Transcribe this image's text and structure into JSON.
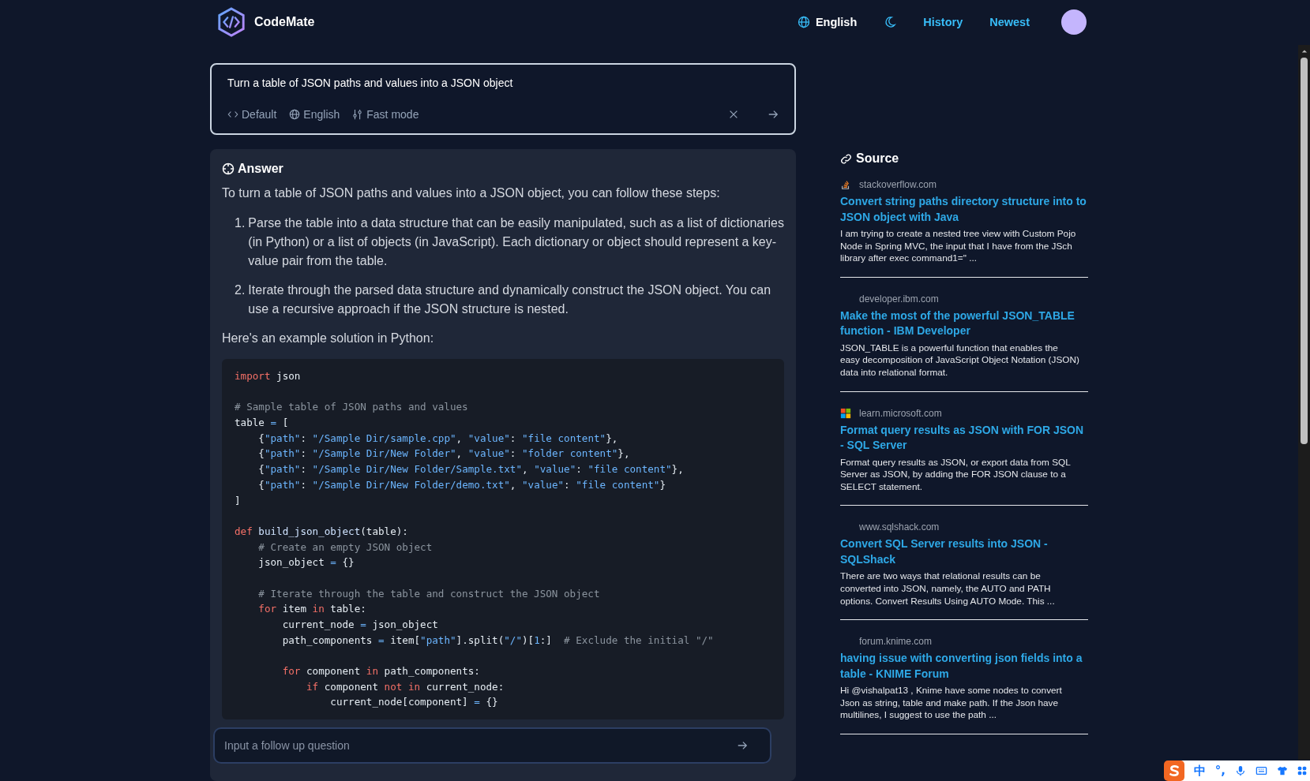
{
  "header": {
    "brand": "CodeMate",
    "language": "English",
    "nav": [
      {
        "label": "History"
      },
      {
        "label": "Newest"
      }
    ]
  },
  "search": {
    "query": "Turn a table of JSON paths and values into a JSON object",
    "options": [
      {
        "kind": "code",
        "label": "Default"
      },
      {
        "kind": "globe",
        "label": "English"
      },
      {
        "kind": "sliders",
        "label": "Fast mode"
      }
    ]
  },
  "answer": {
    "title": "Answer",
    "intro": "To turn a table of JSON paths and values into a JSON object, you can follow these steps:",
    "steps": [
      {
        "num": "1.",
        "text": "Parse the table into a data structure that can be easily manipulated, such as a list of dictionaries (in Python) or a list of objects (in JavaScript). Each dictionary or object should represent a key-value pair from the table."
      },
      {
        "num": "2.",
        "text": "Iterate through the parsed data structure and dynamically construct the JSON object. You can use a recursive approach if the JSON structure is nested."
      }
    ],
    "outro": "Here's an example solution in Python:",
    "code": [
      {
        "kind": "code",
        "tokens": [
          {
            "t": "import",
            "kind": "kw"
          },
          {
            "t": " json",
            "kind": "plain"
          }
        ]
      },
      {
        "kind": "blank"
      },
      {
        "kind": "code",
        "tokens": [
          {
            "t": "# Sample table of JSON paths and values",
            "kind": "cmt"
          }
        ]
      },
      {
        "kind": "code",
        "tokens": [
          {
            "t": "table ",
            "kind": "plain"
          },
          {
            "t": "=",
            "kind": "op"
          },
          {
            "t": " [",
            "kind": "plain"
          }
        ]
      },
      {
        "kind": "code",
        "tokens": [
          {
            "t": "    {",
            "kind": "plain"
          },
          {
            "t": "\"path\"",
            "kind": "str"
          },
          {
            "t": ": ",
            "kind": "plain"
          },
          {
            "t": "\"/Sample Dir/sample.cpp\"",
            "kind": "str"
          },
          {
            "t": ", ",
            "kind": "plain"
          },
          {
            "t": "\"value\"",
            "kind": "str"
          },
          {
            "t": ": ",
            "kind": "plain"
          },
          {
            "t": "\"file content\"",
            "kind": "str"
          },
          {
            "t": "},",
            "kind": "plain"
          }
        ]
      },
      {
        "kind": "code",
        "tokens": [
          {
            "t": "    {",
            "kind": "plain"
          },
          {
            "t": "\"path\"",
            "kind": "str"
          },
          {
            "t": ": ",
            "kind": "plain"
          },
          {
            "t": "\"/Sample Dir/New Folder\"",
            "kind": "str"
          },
          {
            "t": ", ",
            "kind": "plain"
          },
          {
            "t": "\"value\"",
            "kind": "str"
          },
          {
            "t": ": ",
            "kind": "plain"
          },
          {
            "t": "\"folder content\"",
            "kind": "str"
          },
          {
            "t": "},",
            "kind": "plain"
          }
        ]
      },
      {
        "kind": "code",
        "tokens": [
          {
            "t": "    {",
            "kind": "plain"
          },
          {
            "t": "\"path\"",
            "kind": "str"
          },
          {
            "t": ": ",
            "kind": "plain"
          },
          {
            "t": "\"/Sample Dir/New Folder/Sample.txt\"",
            "kind": "str"
          },
          {
            "t": ", ",
            "kind": "plain"
          },
          {
            "t": "\"value\"",
            "kind": "str"
          },
          {
            "t": ": ",
            "kind": "plain"
          },
          {
            "t": "\"file content\"",
            "kind": "str"
          },
          {
            "t": "},",
            "kind": "plain"
          }
        ]
      },
      {
        "kind": "code",
        "tokens": [
          {
            "t": "    {",
            "kind": "plain"
          },
          {
            "t": "\"path\"",
            "kind": "str"
          },
          {
            "t": ": ",
            "kind": "plain"
          },
          {
            "t": "\"/Sample Dir/New Folder/demo.txt\"",
            "kind": "str"
          },
          {
            "t": ", ",
            "kind": "plain"
          },
          {
            "t": "\"value\"",
            "kind": "str"
          },
          {
            "t": ": ",
            "kind": "plain"
          },
          {
            "t": "\"file content\"",
            "kind": "str"
          },
          {
            "t": "}",
            "kind": "plain"
          }
        ]
      },
      {
        "kind": "code",
        "tokens": [
          {
            "t": "]",
            "kind": "plain"
          }
        ]
      },
      {
        "kind": "blank"
      },
      {
        "kind": "code",
        "tokens": [
          {
            "t": "def",
            "kind": "kw"
          },
          {
            "t": " build_json_object",
            "kind": "fn"
          },
          {
            "t": "(table):",
            "kind": "plain"
          }
        ]
      },
      {
        "kind": "code",
        "tokens": [
          {
            "t": "    # Create an empty JSON object",
            "kind": "cmt"
          }
        ]
      },
      {
        "kind": "code",
        "tokens": [
          {
            "t": "    json_object ",
            "kind": "plain"
          },
          {
            "t": "=",
            "kind": "op"
          },
          {
            "t": " {}",
            "kind": "plain"
          }
        ]
      },
      {
        "kind": "blank"
      },
      {
        "kind": "code",
        "tokens": [
          {
            "t": "    # Iterate through the table and construct the JSON object",
            "kind": "cmt"
          }
        ]
      },
      {
        "kind": "code",
        "tokens": [
          {
            "t": "    for",
            "kind": "kw"
          },
          {
            "t": " item ",
            "kind": "plain"
          },
          {
            "t": "in",
            "kind": "kw"
          },
          {
            "t": " table:",
            "kind": "plain"
          }
        ]
      },
      {
        "kind": "code",
        "tokens": [
          {
            "t": "        current_node ",
            "kind": "plain"
          },
          {
            "t": "=",
            "kind": "op"
          },
          {
            "t": " json_object",
            "kind": "plain"
          }
        ]
      },
      {
        "kind": "code",
        "tokens": [
          {
            "t": "        path_components ",
            "kind": "plain"
          },
          {
            "t": "=",
            "kind": "op"
          },
          {
            "t": " item[",
            "kind": "plain"
          },
          {
            "t": "\"path\"",
            "kind": "str"
          },
          {
            "t": "].split(",
            "kind": "plain"
          },
          {
            "t": "\"/\"",
            "kind": "str"
          },
          {
            "t": ")[",
            "kind": "plain"
          },
          {
            "t": "1",
            "kind": "num"
          },
          {
            "t": ":]  ",
            "kind": "plain"
          },
          {
            "t": "# Exclude the initial \"/\"",
            "kind": "cmt"
          }
        ]
      },
      {
        "kind": "blank"
      },
      {
        "kind": "code",
        "tokens": [
          {
            "t": "        for",
            "kind": "kw"
          },
          {
            "t": " component ",
            "kind": "plain"
          },
          {
            "t": "in",
            "kind": "kw"
          },
          {
            "t": " path_components:",
            "kind": "plain"
          }
        ]
      },
      {
        "kind": "code",
        "tokens": [
          {
            "t": "            if",
            "kind": "kw"
          },
          {
            "t": " component ",
            "kind": "plain"
          },
          {
            "t": "not",
            "kind": "kw"
          },
          {
            "t": " in",
            "kind": "kw"
          },
          {
            "t": " current_node:",
            "kind": "plain"
          }
        ]
      },
      {
        "kind": "code",
        "tokens": [
          {
            "t": "                current_node[component] ",
            "kind": "plain"
          },
          {
            "t": "=",
            "kind": "op"
          },
          {
            "t": " {}",
            "kind": "plain"
          }
        ]
      }
    ]
  },
  "followup": {
    "placeholder": "Input a follow up question"
  },
  "sources": {
    "title": "Source",
    "items": [
      {
        "kind": "stackoverflow",
        "domain": "stackoverflow.com",
        "title": "Convert string paths directory structure into to JSON object with Java",
        "snippet": "I am trying to create a nested tree view with Custom Pojo Node in Spring MVC, the input that I have from the JSch library after exec command1=\" ..."
      },
      {
        "kind": "blank",
        "domain": "developer.ibm.com",
        "title": "Make the most of the powerful JSON_TABLE function - IBM Developer",
        "snippet": "JSON_TABLE is a powerful function that enables the easy decomposition of JavaScript Object Notation (JSON) data into relational format."
      },
      {
        "kind": "microsoft",
        "domain": "learn.microsoft.com",
        "title": "Format query results as JSON with FOR JSON - SQL Server",
        "snippet": "Format query results as JSON, or export data from SQL Server as JSON, by adding the FOR JSON clause to a SELECT statement."
      },
      {
        "kind": "blank",
        "domain": "www.sqlshack.com",
        "title": "Convert SQL Server results into JSON - SQLShack",
        "snippet": "There are two ways that relational results can be converted into JSON, namely, the AUTO and PATH options. Convert Results Using AUTO Mode. This ..."
      },
      {
        "kind": "blank",
        "domain": "forum.knime.com",
        "title": "having issue with converting json fields into a table - KNIME Forum",
        "snippet": "Hi @vishalpat13 , Knime have some nodes to convert Json as string, table and make path. If the Json have multilines, I suggest to use the path ..."
      }
    ]
  },
  "ime_toolbar": {
    "mode": "中",
    "punctuation": "°,"
  }
}
